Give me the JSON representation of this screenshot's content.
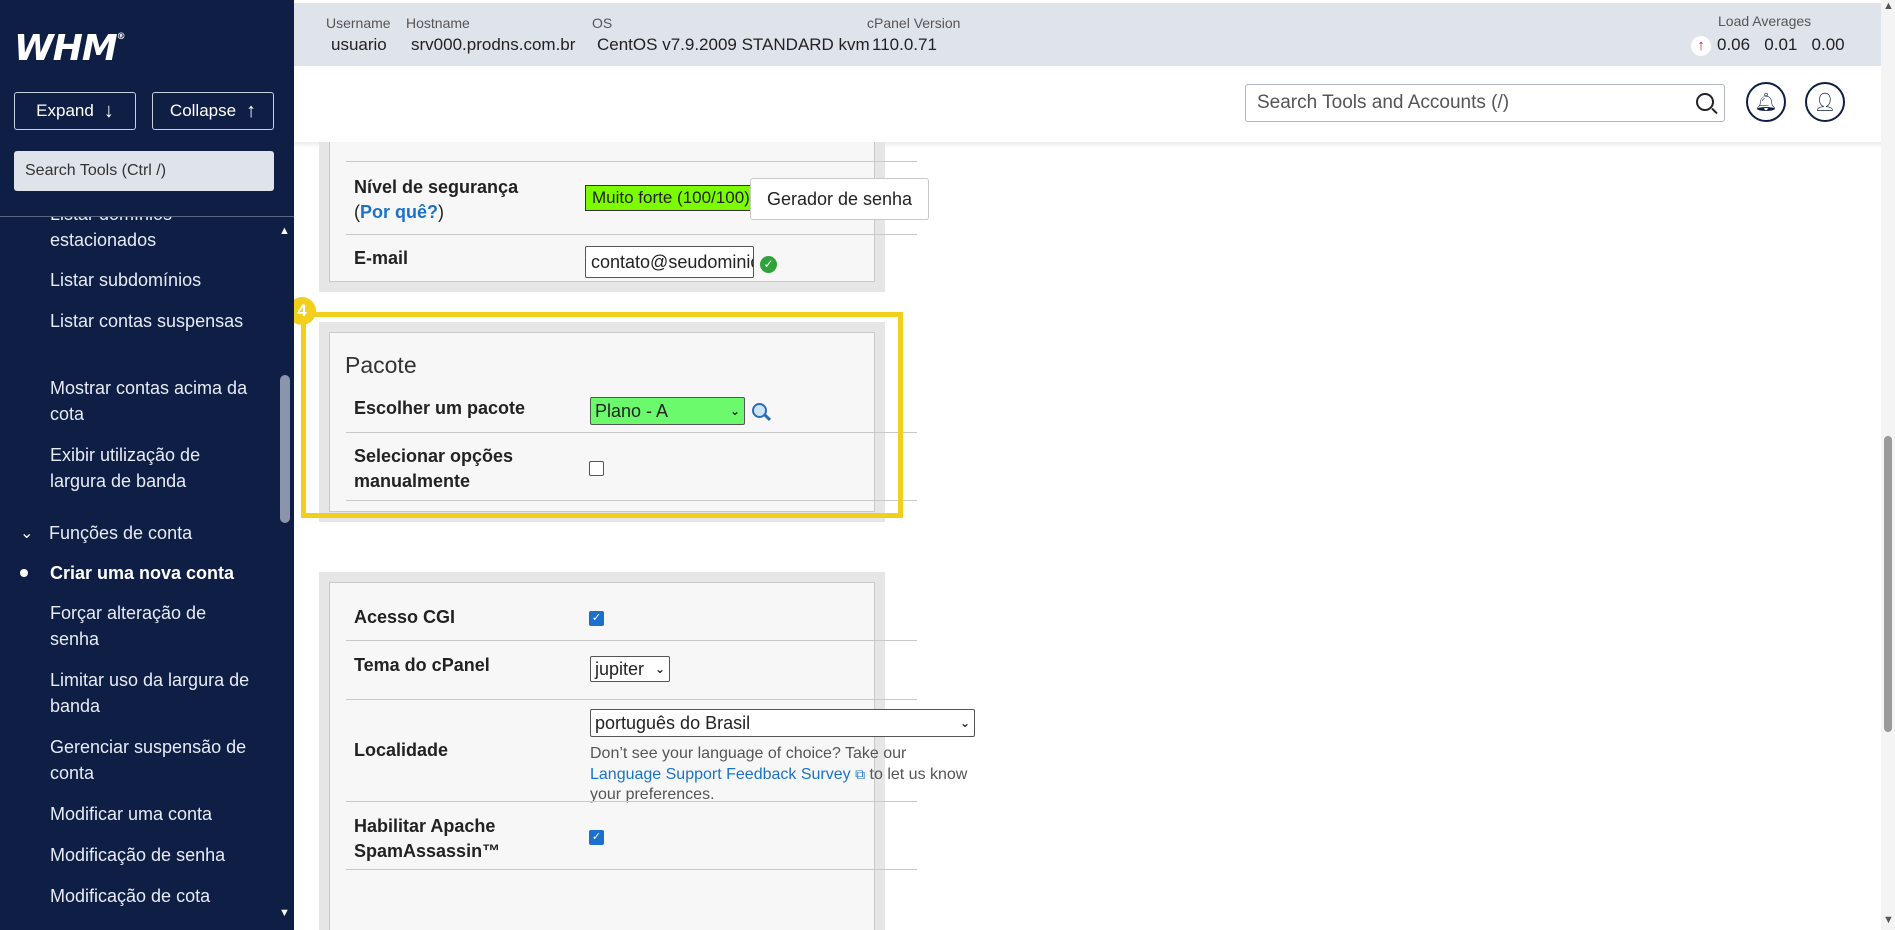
{
  "app": {
    "logo": "WHM",
    "logo_mark": "®"
  },
  "sidebar": {
    "expand_label": "Expand",
    "collapse_label": "Collapse",
    "search_placeholder": "Search Tools (Ctrl /)",
    "items": [
      {
        "label": "Listar domínios estacionados"
      },
      {
        "label": "Listar subdomínios"
      },
      {
        "label": "Listar contas suspensas"
      },
      {
        "label": "Mostrar contas acima da cota"
      },
      {
        "label": "Exibir utilização de largura de banda"
      },
      {
        "label": "Funções de conta"
      },
      {
        "label": "Criar uma nova conta"
      },
      {
        "label": "Forçar alteração de senha"
      },
      {
        "label": "Limitar uso da largura de banda"
      },
      {
        "label": "Gerenciar suspensão de conta"
      },
      {
        "label": "Modificar uma conta"
      },
      {
        "label": "Modificação de senha"
      },
      {
        "label": "Modificação de cota"
      }
    ]
  },
  "topbar": {
    "username_label": "Username",
    "username": "usuario",
    "hostname_label": "Hostname",
    "hostname": "srv000.prodns.com.br",
    "os_label": "OS",
    "os": "CentOS v7.9.2009 STANDARD kvm",
    "cpanel_label": "cPanel Version",
    "cpanel": "110.0.71",
    "load_label": "Load Averages",
    "load1": "0.06",
    "load2": "0.01",
    "load3": "0.00"
  },
  "header": {
    "search_placeholder": "Search Tools and Accounts (/)"
  },
  "form": {
    "security_label": "Nível de segurança",
    "security_open": "(",
    "why_link": "Por quê?",
    "security_close": ")",
    "strength": "Muito forte (100/100)",
    "generator_button": "Gerador de senha",
    "email_label": "E-mail",
    "email_value": "contato@seudominio.com",
    "step_badge": "4",
    "package_title": "Pacote",
    "choose_package_label": "Escolher um pacote",
    "package_value": "Plano - A",
    "manual_options_label": "Selecionar opções manualmente",
    "cgi_label": "Acesso CGI",
    "theme_label": "Tema do cPanel",
    "theme_value": "jupiter",
    "locale_label": "Localidade",
    "locale_value": "português do Brasil",
    "locale_help_1": "Don’t see your language of choice? Take our",
    "locale_help_link": "Language Support Feedback Survey",
    "locale_help_2": "to let us know your preferences.",
    "spam_label": "Habilitar Apache SpamAssassin™"
  }
}
